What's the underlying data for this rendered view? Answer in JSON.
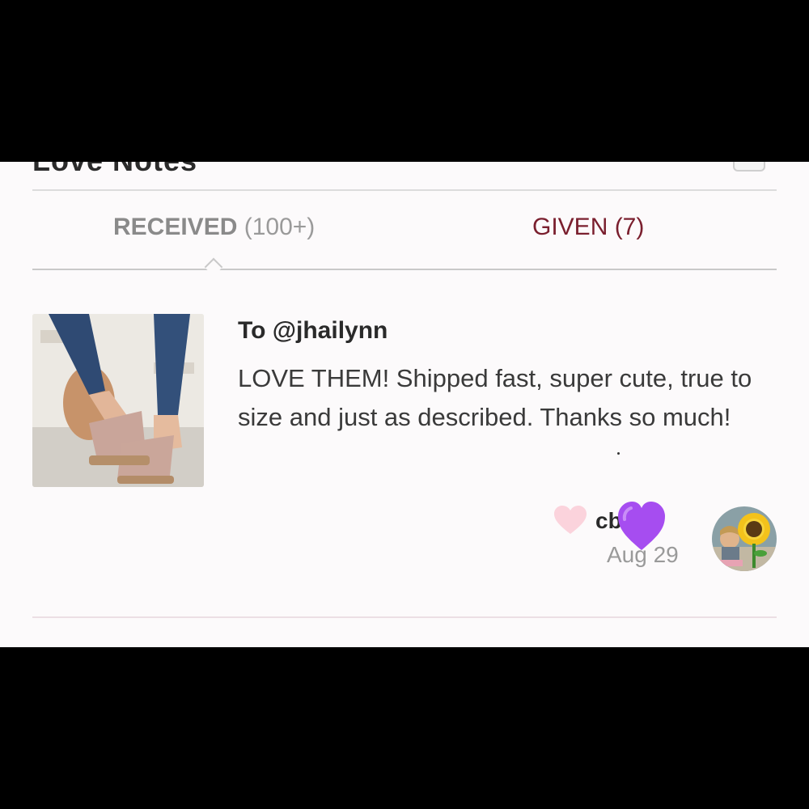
{
  "section": {
    "title": "Love Notes"
  },
  "tabs": [
    {
      "label": "RECEIVED",
      "count": "(100+)"
    },
    {
      "label": "GIVEN (7)"
    }
  ],
  "note": {
    "to": "To @jhailynn",
    "message": "LOVE THEM! Shipped fast, super cute, true to size and just as described. Thanks so much!",
    "author": "cb     ini",
    "date": "Aug 29"
  },
  "icons": {
    "like": "heart-icon",
    "mask": "purple-heart-emoji",
    "avatar": "sunflower-avatar"
  },
  "colors": {
    "accent": "#7a1f2e",
    "heart": "#fbd3dc",
    "purple_heart": "#a64df0"
  }
}
